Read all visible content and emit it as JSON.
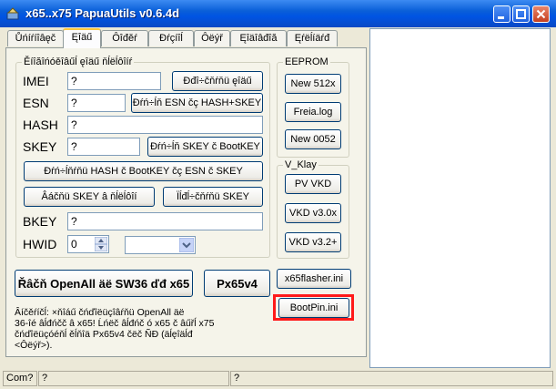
{
  "window": {
    "title": "x65..x75 PapuaUtils v0.6.4d"
  },
  "tabs": [
    {
      "label": "Ůńíŕíîâęč"
    },
    {
      "label": "Ęîäű"
    },
    {
      "label": "Ôîđěŕ"
    },
    {
      "label": "Đŕçíîĺ"
    },
    {
      "label": "Ôëýř"
    },
    {
      "label": "Ęîäîâđîă"
    },
    {
      "label": "Ęŕëĺíäŕđ"
    }
  ],
  "main": {
    "group_title": "Ěíîăîńóěîâűĺ ęîäű ňĺëĺôîíŕ",
    "imei": {
      "label": "IMEI",
      "value": "?",
      "button": "Đđî÷čňŕňü ęîäű"
    },
    "esn": {
      "label": "ESN",
      "value": "?",
      "button": "Đŕń÷ĺň ESN čç HASH+SKEY"
    },
    "hash": {
      "label": "HASH",
      "value": "?"
    },
    "skey": {
      "label": "SKEY",
      "value": "?",
      "button": "Đŕń÷ĺň SKEY č BootKEY"
    },
    "calc_hash_button": "Đŕń÷ĺňŕňü HASH č BootKEY čç ESN č SKEY",
    "write_skey_button": "Âáčňü SKEY â ňĺëĺôîí",
    "read_skey_button": "Ïĺđĺ÷čňŕňü SKEY",
    "bkey": {
      "label": "BKEY",
      "value": "?"
    },
    "hwid": {
      "label": "HWID",
      "value": "0",
      "select_value": ""
    },
    "openall_button": "Řâčň OpenAll äë SW36 ďđ x65",
    "px65_button": "Px65v4",
    "note": "Âíčěŕíčĺ: ×ňîáű čńďîëüçîâŕňü OpenAll äë\n36-îé âĺđńčč â x65! Ĺńëč âĺđńč ó x65 č âűřĺ x75\nčńďîëüçóéňĺ ěĺňîä Px65v4 čëč ÑĐ (äĺęîäĺđ\n<Ôëýř>)."
  },
  "eeprom": {
    "title": "EEPROM",
    "buttons": [
      "New 512x",
      "Freia.log",
      "New 0052"
    ]
  },
  "vklay": {
    "title": "V_Klay",
    "buttons": [
      "PV VKD",
      "VKD v3.0x",
      "VKD v3.2+"
    ]
  },
  "side_buttons": {
    "flasher": "x65flasher.ini",
    "bootpin": "BootPin.ini"
  },
  "status": {
    "com": "Com?",
    "cell2": "?",
    "cell3": "?"
  },
  "colors": {
    "titlebar": "#0054e3",
    "highlight": "#ff1a1a",
    "face": "#ece9d8"
  }
}
